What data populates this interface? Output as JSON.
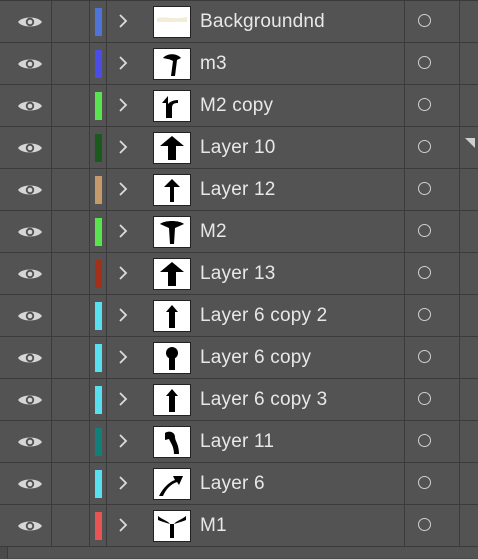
{
  "layers": [
    {
      "name": "Backgroundnd",
      "color": "#4d74d6",
      "thumb": "bg"
    },
    {
      "name": "m3",
      "color": "#4a4ee6",
      "thumb": "m3"
    },
    {
      "name": "M2 copy",
      "color": "#59e34f",
      "thumb": "m2copy"
    },
    {
      "name": "Layer 10",
      "color": "#1a5a1d",
      "thumb": "up-wide"
    },
    {
      "name": "Layer 12",
      "color": "#c49a6c",
      "thumb": "up-thin"
    },
    {
      "name": "M2",
      "color": "#59e34f",
      "thumb": "mush"
    },
    {
      "name": "Layer 13",
      "color": "#a2301a",
      "thumb": "up-wide"
    },
    {
      "name": "Layer 6 copy 2",
      "color": "#58dff0",
      "thumb": "up-med"
    },
    {
      "name": "Layer 6 copy",
      "color": "#58dff0",
      "thumb": "up-round"
    },
    {
      "name": "Layer 6 copy 3",
      "color": "#58dff0",
      "thumb": "up-med"
    },
    {
      "name": "Layer 11",
      "color": "#137f7a",
      "thumb": "hook"
    },
    {
      "name": "Layer 6",
      "color": "#58dff0",
      "thumb": "curve"
    },
    {
      "name": "M1",
      "color": "#e85454",
      "thumb": "y"
    }
  ],
  "icons": {
    "visibility": "eye-icon",
    "expand": "chevron-right-icon",
    "target": "target-circle-icon"
  }
}
